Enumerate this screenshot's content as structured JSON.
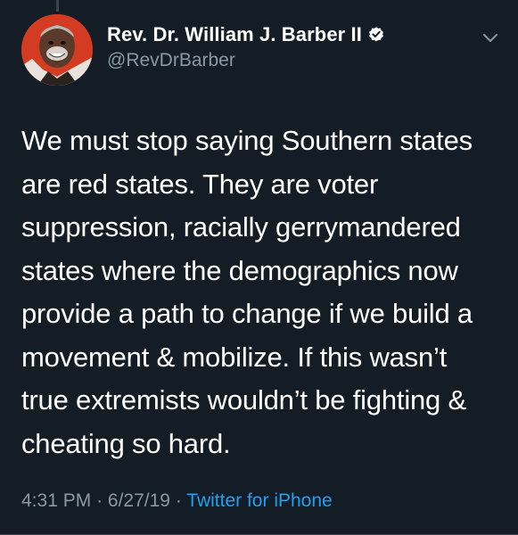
{
  "author": {
    "display_name": "Rev. Dr. William J. Barber II",
    "handle": "@RevDrBarber",
    "verified": true,
    "avatar_icon": "profile-photo"
  },
  "tweet": {
    "lines": [
      "We must stop saying Southern states",
      "are red states. They are voter",
      "suppression, racially gerrymandered",
      "states where the demographics now",
      "provide a path to change if we build a",
      "movement & mobilize. If this wasn’t",
      "true extremists wouldn’t be fighting &",
      "cheating so hard."
    ]
  },
  "meta": {
    "time": "4:31 PM",
    "separator": "·",
    "date": "6/27/19",
    "source": "Twitter for iPhone"
  },
  "icons": {
    "verified": "verified-badge-icon",
    "more": "chevron-down-icon"
  },
  "colors": {
    "background": "#141d26",
    "primary_text": "#ffffff",
    "secondary_text": "#8899a6",
    "link": "#1da1f2",
    "verified_badge": "#ffffff"
  }
}
